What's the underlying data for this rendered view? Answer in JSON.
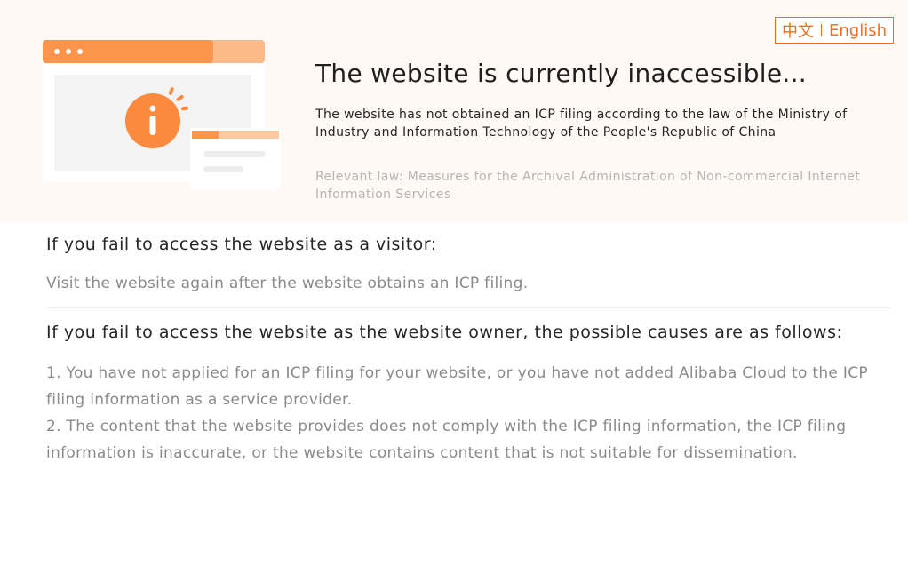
{
  "language": {
    "zh_label": "中文",
    "en_label": "English"
  },
  "hero": {
    "title": "The website is currently inaccessible...",
    "description": "The website has not obtained an ICP filing according to the law of the Ministry of Industry and Information Technology of the People's Republic of China",
    "law": "Relevant law: Measures for the Archival Administration of Non-commercial Internet Information Services",
    "illustration_icon": "info-icon"
  },
  "visitor": {
    "title": "If you fail to access the website as a visitor:",
    "text": "Visit the website again after the website obtains an ICP filing."
  },
  "owner": {
    "title": "If you fail to access the website as the website owner, the possible causes are as follows:",
    "causes": [
      "1. You have not applied for an ICP filing for your website, or you have not added Alibaba Cloud to the ICP filing information as a service provider.",
      "2. The content that the website provides does not comply with the ICP filing information, the ICP filing information is inaccurate, or the website contains content that is not suitable for dissemination."
    ]
  },
  "colors": {
    "accent": "#f26d21",
    "hero_background": "#fff8f4",
    "muted_text": "#8a8a8a"
  }
}
